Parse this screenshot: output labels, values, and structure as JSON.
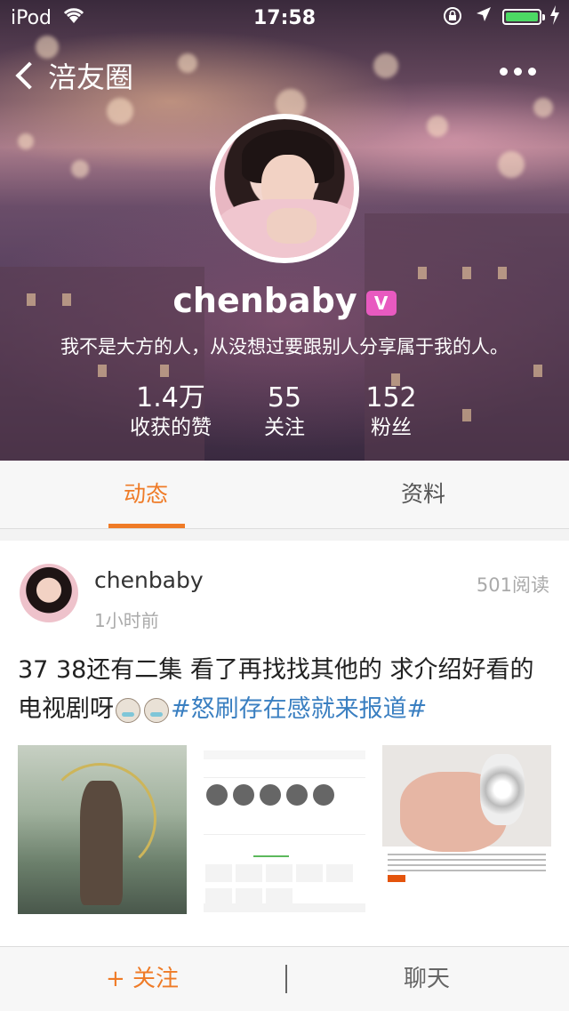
{
  "status_bar": {
    "carrier": "iPod",
    "time": "17:58"
  },
  "nav": {
    "back_label": "涪友圈"
  },
  "profile": {
    "username": "chenbaby",
    "v_badge": "V",
    "bio": "我不是大方的人，从没想过要跟别人分享属于我的人。",
    "stats": [
      {
        "value": "1.4万",
        "label": "收获的赞"
      },
      {
        "value": "55",
        "label": "关注"
      },
      {
        "value": "152",
        "label": "粉丝"
      }
    ]
  },
  "tabs": [
    {
      "label": "动态",
      "active": true
    },
    {
      "label": "资料",
      "active": false
    }
  ],
  "post": {
    "user": "chenbaby",
    "time": "1小时前",
    "reads": "501阅读",
    "text": "37 38还有二集 看了再找找其他的 求介绍好看的电视剧呀",
    "hashtag": "#怒刷存在感就来报道#"
  },
  "bottom": {
    "follow_label": "+ 关注",
    "chat_label": "聊天"
  },
  "colors": {
    "accent": "#ef7b27",
    "hashtag": "#3a7fc1",
    "battery": "#4cd964",
    "v_badge": "#e85ac0"
  }
}
